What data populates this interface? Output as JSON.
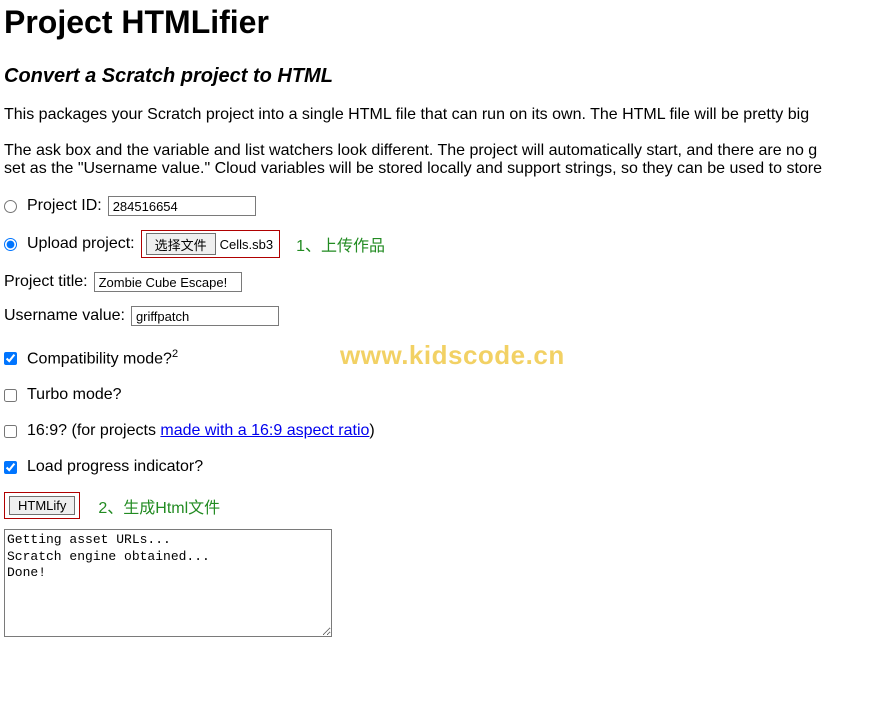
{
  "header": {
    "title": "Project HTMLifier",
    "subtitle": "Convert a Scratch project to HTML"
  },
  "description": {
    "p1": "This packages your Scratch project into a single HTML file that can run on its own. The HTML file will be pretty big",
    "p2": "The ask box and the variable and list watchers look different. The project will automatically start, and there are no g",
    "p3": "set as the \"Username value.\" Cloud variables will be stored locally and support strings, so they can be used to store"
  },
  "form": {
    "project_id": {
      "label": "Project ID:",
      "value": "284516654"
    },
    "upload": {
      "label": "Upload project:",
      "button": "选择文件",
      "filename": "Cells.sb3",
      "annotation": "1、上传作品"
    },
    "title": {
      "label": "Project title:",
      "value": "Zombie Cube Escape!"
    },
    "username": {
      "label": "Username value:",
      "value": "griffpatch"
    },
    "compat": {
      "label": "Compatibility mode?",
      "sup": "2",
      "checked": true
    },
    "turbo": {
      "label": "Turbo mode?",
      "checked": false
    },
    "ratio": {
      "prefix": "16:9? (for projects ",
      "link": "made with a 16:9 aspect ratio",
      "suffix": ")",
      "checked": false
    },
    "progress": {
      "label": "Load progress indicator?",
      "checked": true
    }
  },
  "action": {
    "button": "HTMLify",
    "annotation": "2、生成Html文件"
  },
  "log": "Getting asset URLs...\nScratch engine obtained...\nDone!",
  "watermark": "www.kidscode.cn"
}
